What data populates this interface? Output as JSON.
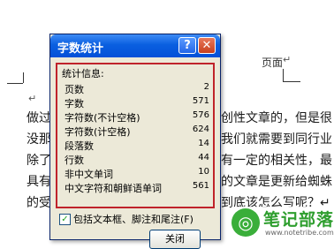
{
  "document": {
    "page_label": "页面",
    "paragraph_mark": "↵",
    "lines": [
      {
        "left": "做过",
        "right": "创性文章的，但是很"
      },
      {
        "left": "没那",
        "right": "我们就需要到同行业"
      },
      {
        "left": "除了",
        "right": "有一定的相关性，最"
      },
      {
        "left": "具有",
        "right": "的文章是更新给蜘蛛"
      },
      {
        "left": "的受",
        "right": "到底该怎么写呢？↵"
      }
    ]
  },
  "dialog": {
    "title": "字数统计",
    "help_label": "?",
    "close_label": "✕",
    "stats_label": "统计信息:",
    "stats": [
      {
        "key": "页数",
        "value": "2"
      },
      {
        "key": "字数",
        "value": "571"
      },
      {
        "key": "字符数(不计空格)",
        "value": "576"
      },
      {
        "key": "字符数(计空格)",
        "value": "624"
      },
      {
        "key": "段落数",
        "value": "14"
      },
      {
        "key": "行数",
        "value": "44"
      },
      {
        "key": "非中文单词",
        "value": "10"
      },
      {
        "key": "中文字符和朝鲜语单词",
        "value": "561"
      }
    ],
    "include_label": "包括文本框、脚注和尾注(F)",
    "include_checked": "✓",
    "close_button_label": "关闭"
  },
  "watermark": {
    "logo": "◎",
    "text": "笔记部落",
    "url": "www.notetribe.com"
  }
}
